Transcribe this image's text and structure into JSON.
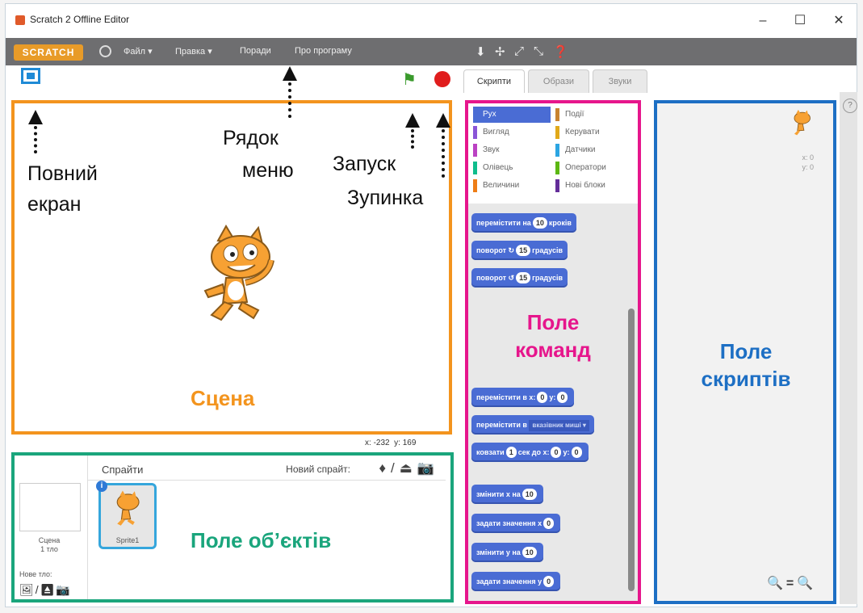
{
  "window": {
    "title": "Scratch 2 Offline Editor",
    "controls": [
      "–",
      "☐",
      "✕"
    ]
  },
  "menubar": {
    "logo": "SCRATCH",
    "items": [
      "Файл ▾",
      "Правка ▾",
      "Поради",
      "Про програму"
    ]
  },
  "tabs": [
    "Скрипти",
    "Образи",
    "Звуки"
  ],
  "categories": {
    "left": [
      "Рух",
      "Вигляд",
      "Звук",
      "Олівець",
      "Величини"
    ],
    "right": [
      "Події",
      "Керувати",
      "Датчики",
      "Оператори",
      "Нові блоки"
    ]
  },
  "blocks": [
    {
      "pre": "перемістити на",
      "num": "10",
      "post": "кроків"
    },
    {
      "pre": "поворот ↻",
      "num": "15",
      "post": "градусів"
    },
    {
      "pre": "поворот ↺",
      "num": "15",
      "post": "градусів"
    },
    {
      "pre": "перемістити в x:",
      "num": "0",
      "mid": "y:",
      "num2": "0"
    },
    {
      "pre": "перемістити в",
      "drop": "вказівник миші ▾"
    },
    {
      "pre": "ковзати",
      "num": "1",
      "mid": "сек до x:",
      "num2": "0",
      "mid2": "y:",
      "num3": "0"
    },
    {
      "pre": "змінити x на",
      "num": "10"
    },
    {
      "pre": "задати значення x",
      "num": "0"
    },
    {
      "pre": "змінити y на",
      "num": "10"
    },
    {
      "pre": "задати значення y",
      "num": "0"
    }
  ],
  "stage": {
    "coords_x_label": "x:",
    "coords_x": "-232",
    "coords_y_label": "y:",
    "coords_y": "169"
  },
  "sprites": {
    "title": "Спрайти",
    "new_sprite": "Новий спрайт:",
    "scene_label": "Сцена",
    "scene_sub": "1 тло",
    "new_backdrop": "Нове тло:",
    "sprite_name": "Sprite1"
  },
  "scripts_area": {
    "x_label": "x: 0",
    "y_label": "y: 0"
  },
  "annotations": {
    "fullscreen_1": "Повний",
    "fullscreen_2": "екран",
    "menu_1": "Рядок",
    "menu_2": "меню",
    "start": "Запуск",
    "stop": "Зупинка",
    "stage": "Сцена",
    "blocks_1": "Поле",
    "blocks_2": "команд",
    "scripts_1": "Поле",
    "scripts_2": "скриптів",
    "sprites": "Поле об’єктів"
  },
  "colors": {
    "stage_frame": "#f3941e",
    "sprites_frame": "#1aa57c",
    "blocks_frame": "#e6168c",
    "scripts_frame": "#1d6fc4",
    "motion_block": "#4a6cd4"
  }
}
